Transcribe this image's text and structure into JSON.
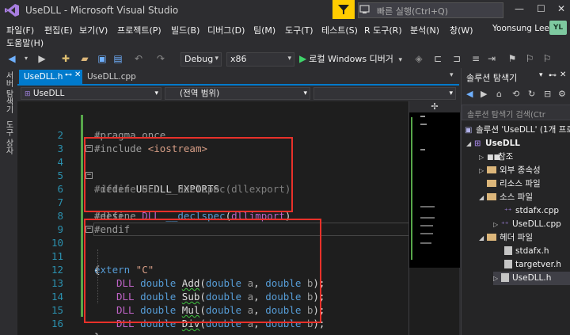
{
  "window": {
    "title": "UseDLL - Microsoft Visual Studio",
    "search_placeholder": "빠른 실행(Ctrl+Q)",
    "minimize": "—",
    "maximize": "☐",
    "close": "✕"
  },
  "menu": {
    "items": [
      "파일(F)",
      "편집(E)",
      "보기(V)",
      "프로젝트(P)",
      "빌드(B)",
      "디버그(D)",
      "팀(M)",
      "도구(T)",
      "테스트(S)",
      "R 도구(R)",
      "분석(N)",
      "창(W)"
    ],
    "help": "도움말(H)",
    "user": "Yoonsung Lee",
    "avatar_initials": "YL"
  },
  "toolbar": {
    "config": "Debug",
    "platform": "x86",
    "run_label": "로컬 Windows 디버거"
  },
  "side_tabs": [
    "서버 탐색기",
    "도구 상자"
  ],
  "doc_tabs": [
    {
      "label": "UseDLL.h",
      "active": true
    },
    {
      "label": "UseDLL.cpp",
      "active": false
    }
  ],
  "nav": {
    "project": "UseDLL",
    "scope": "(전역 범위)"
  },
  "editor": {
    "line_numbers": [
      "",
      "2",
      "3",
      "4",
      "5",
      "6",
      "7",
      "8",
      "9",
      "10",
      "11",
      "12",
      "13",
      "14",
      "15",
      "16"
    ],
    "lines": {
      "l1": {
        "pp": "#pragma once"
      },
      "l2": {
        "pp": "#include ",
        "str": "<iostream>"
      },
      "l4": {
        "pp": "#ifdef ",
        "name": "USEDLL_EXPORTS"
      },
      "l5": {
        "pp": "#define ",
        "macro": "DLL",
        "kw": "__declspec",
        "open": "(",
        "arg": "dllexport",
        "close": ")"
      },
      "l6": {
        "pp": "#else"
      },
      "l7": {
        "pp": "#define ",
        "macro": "DLL",
        "kw": "__declspec",
        "open": "(",
        "arg": "dllimport",
        "close": ")"
      },
      "l8": {
        "pp": "#endif"
      },
      "l10": {
        "kw": "extern",
        "str": " \"C\""
      },
      "l11": {
        "text": "{"
      },
      "l12": {
        "macro": "DLL",
        "type": "double",
        "fn": "Add",
        "p1t": "double",
        "p1": "a",
        "p2t": "double",
        "p2": "b"
      },
      "l13": {
        "macro": "DLL",
        "type": "double",
        "fn": "Sub",
        "p1t": "double",
        "p1": "a",
        "p2t": "double",
        "p2": "b"
      },
      "l14": {
        "macro": "DLL",
        "type": "double",
        "fn": "Mul",
        "p1t": "double",
        "p1": "a",
        "p2t": "double",
        "p2": "b"
      },
      "l15": {
        "macro": "DLL",
        "type": "double",
        "fn": "Div",
        "p1t": "double",
        "p1": "a",
        "p2t": "double",
        "p2": "b"
      },
      "l16": {
        "text": "}"
      }
    }
  },
  "minimap": {
    "split_icon": "✢"
  },
  "solution_explorer": {
    "title": "솔루션 탐색기",
    "search_placeholder": "솔루션 탐색기 검색(Ctr",
    "items": [
      {
        "label": "솔루션 'UseDLL' (1개 프로"
      },
      {
        "label": "UseDLL"
      },
      {
        "label": "참조"
      },
      {
        "label": "외부 종속성"
      },
      {
        "label": "리소스 파일"
      },
      {
        "label": "소스 파일"
      },
      {
        "label": "stdafx.cpp"
      },
      {
        "label": "UseDLL.cpp"
      },
      {
        "label": "헤더 파일"
      },
      {
        "label": "stdafx.h"
      },
      {
        "label": "targetver.h"
      },
      {
        "label": "UseDLL.h"
      }
    ]
  },
  "colors": {
    "accent": "#007acc",
    "highlight_box": "#e8312a",
    "change_bar": "#57a64a"
  }
}
